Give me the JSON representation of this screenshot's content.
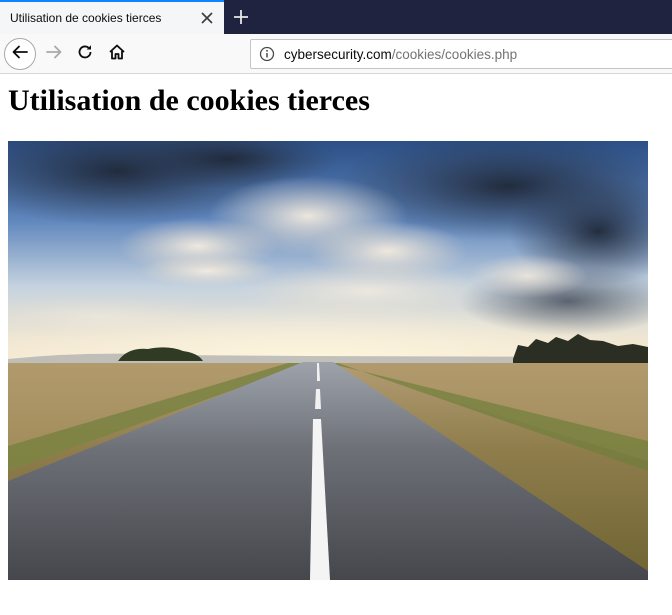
{
  "browser": {
    "tab": {
      "title": "Utilisation de cookies tierces",
      "close_icon": "close-icon"
    },
    "new_tab_icon": "plus-icon",
    "nav": {
      "back_icon": "arrow-left-icon",
      "forward_icon": "arrow-right-icon",
      "reload_icon": "reload-icon",
      "home_icon": "home-icon"
    },
    "url": {
      "info_icon": "info-icon",
      "domain": "cybersecurity.com",
      "path": "/cookies/cookies.php"
    }
  },
  "page": {
    "heading": "Utilisation de cookies tierces",
    "image": {
      "subject": "road-landscape-photo"
    }
  },
  "colors": {
    "tabstrip": "#202340",
    "tab_accent": "#0a84ff",
    "navbar": "#f9f9fa"
  }
}
